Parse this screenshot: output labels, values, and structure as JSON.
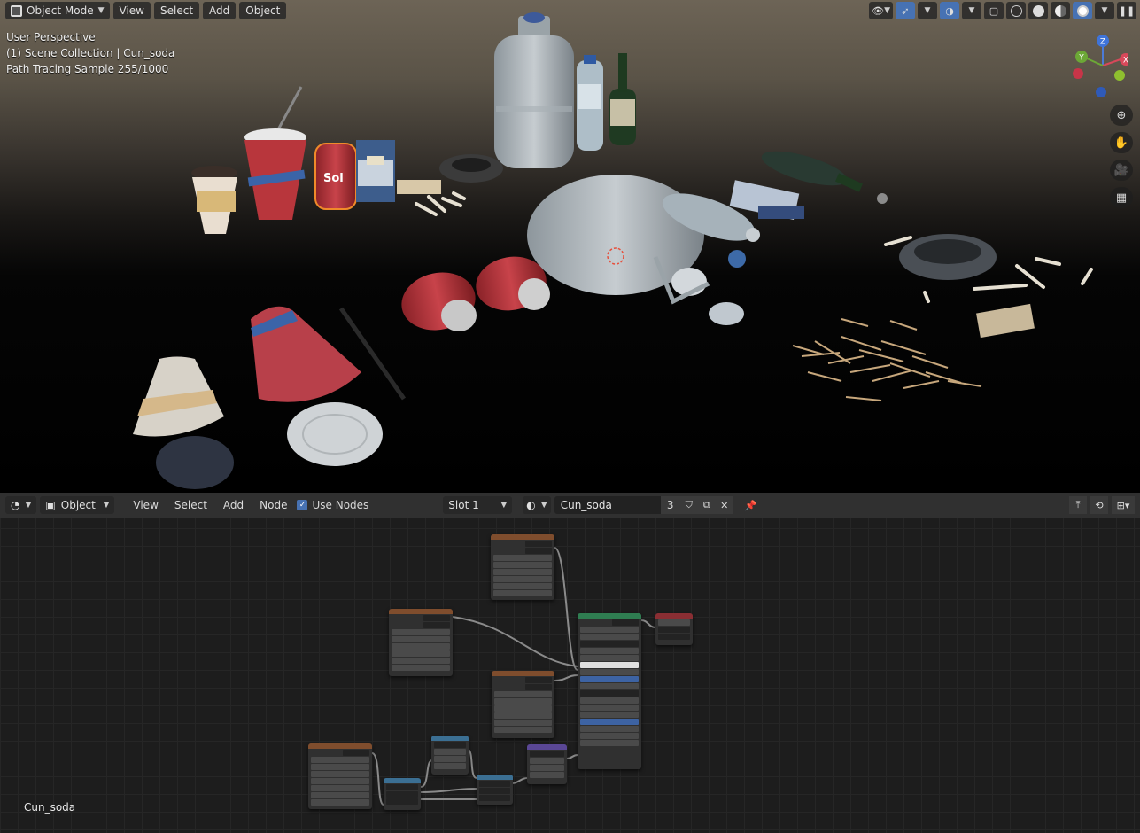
{
  "viewport": {
    "header": {
      "mode": "Object Mode",
      "menus": [
        "View",
        "Select",
        "Add",
        "Object"
      ]
    },
    "overlay": {
      "view_name": "User Perspective",
      "collection": "(1) Scene Collection | Cun_soda",
      "render_status": "Path Tracing Sample 255/1000"
    },
    "gizmo": {
      "z": "Z",
      "y": "Y",
      "x": "X"
    },
    "header_right_icons": [
      "eye-visibility-icon",
      "gizmo-icon",
      "overlay-icon",
      "xray-icon",
      "wireframe-shading",
      "solid-shading",
      "material-shading",
      "rendered-shading",
      "pause-icon"
    ],
    "nav_icons": [
      "zoom-icon",
      "hand-pan-icon",
      "camera-icon",
      "grid-icon"
    ]
  },
  "node_editor": {
    "header": {
      "object_type": "Object",
      "menus": [
        "View",
        "Select",
        "Add",
        "Node"
      ],
      "use_nodes_label": "Use Nodes",
      "use_nodes": true,
      "slot": "Slot 1",
      "material_name": "Cun_soda",
      "user_count": "3"
    },
    "material_label": "Cun_soda"
  }
}
